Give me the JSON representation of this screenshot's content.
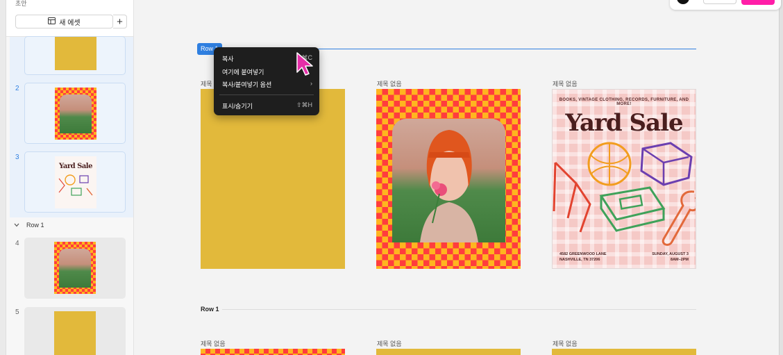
{
  "sidebar": {
    "title": "초안",
    "new_asset_label": "새 에셋",
    "add_label": "+",
    "pages": [
      {
        "num": "",
        "type": "yellow"
      },
      {
        "num": "2",
        "type": "photo"
      },
      {
        "num": "3",
        "type": "yard-sale"
      },
      {
        "num": "4",
        "type": "photo"
      },
      {
        "num": "5",
        "type": "yellow"
      }
    ],
    "row_group_label": "Row 1",
    "thumb_yard_title": "Yard Sale"
  },
  "canvas": {
    "selected_row_chip": "Row 1",
    "row1_items": [
      {
        "title": "제목 없음"
      },
      {
        "title": "제목 없음"
      },
      {
        "title": "제목 없음"
      }
    ],
    "row2_label": "Row 1",
    "row2_items": [
      {
        "title": "제목 없음"
      },
      {
        "title": "제목 없음"
      },
      {
        "title": "제목 없음"
      }
    ]
  },
  "yard_sale": {
    "tagline": "BOOKS, VINTAGE CLOTHING, RECORDS, FURNITURE, AND MORE!",
    "title": "Yard Sale",
    "address_line1": "4582 GREENWOOD LANE",
    "address_line2": "NASHVILLE, TN 37206",
    "date_line1": "SUNDAY, AUGUST 3",
    "date_line2": "8AM–2PM"
  },
  "context_menu": {
    "items": [
      {
        "label": "복사",
        "shortcut": "⌘C"
      },
      {
        "label": "여기에 붙여넣기",
        "shortcut": ""
      },
      {
        "label": "복사/붙여넣기 옵션",
        "shortcut": "›"
      },
      {
        "label": "표시/숨기기",
        "shortcut": "⇧⌘H"
      }
    ]
  },
  "colors": {
    "accent_blue": "#2f7fe0",
    "brand_pink": "#ff1ea8",
    "poster_yellow": "#e2b93b",
    "checker_red": "#ff3d3d",
    "checker_orange": "#ffb51f"
  }
}
